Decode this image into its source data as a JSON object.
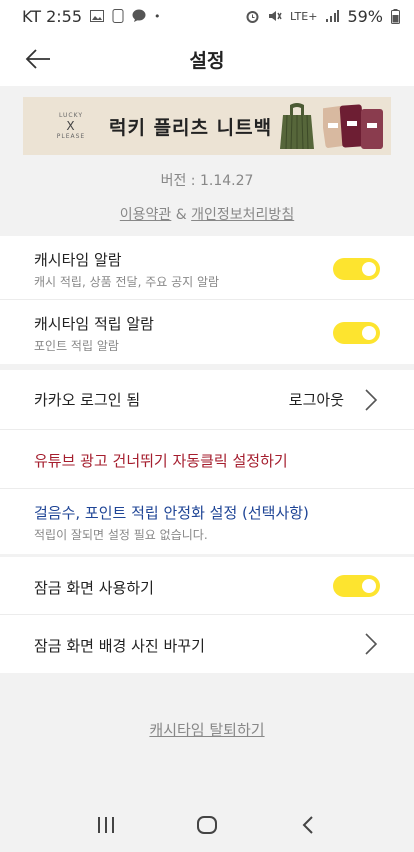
{
  "status_bar": {
    "carrier_time": "KT 2:55",
    "battery": "59%",
    "network": "LTE+"
  },
  "header": {
    "title": "설정",
    "back_icon": "arrow-left-icon"
  },
  "banner": {
    "brand_lines": [
      "LUCKY",
      "X",
      "PLEASE"
    ],
    "text": "럭키 플리츠 니트백"
  },
  "info": {
    "version": "버전 : 1.14.27",
    "terms_label": "이용약관",
    "terms_separator": " & ",
    "privacy_label": "개인정보처리방침"
  },
  "notifications": [
    {
      "title": "캐시타임 알람",
      "subtitle": "캐시 적립, 상품 전달, 주요 공지 알람",
      "enabled": true
    },
    {
      "title": "캐시타임 적립 알람",
      "subtitle": "포인트 적립 알람",
      "enabled": true
    }
  ],
  "account": {
    "login_status": "카카오 로그인 됨",
    "logout_label": "로그아웃",
    "youtube_setting": "유튜브 광고 건너뛰기 자동클릭 설정하기",
    "steps_setting_title": "걸음수, 포인트 적립 안정화 설정 (선택사항)",
    "steps_setting_sub": "적립이 잘되면 설정 필요 없습니다."
  },
  "lockscreen": {
    "use_label": "잠금 화면 사용하기",
    "use_enabled": true,
    "change_bg_label": "잠금 화면 배경 사진 바꾸기"
  },
  "footer": {
    "withdraw_label": "캐시타임 탈퇴하기"
  },
  "colors": {
    "toggle_on": "#fde42f",
    "youtube_text": "#a51e2e",
    "steps_text": "#1f4596"
  }
}
